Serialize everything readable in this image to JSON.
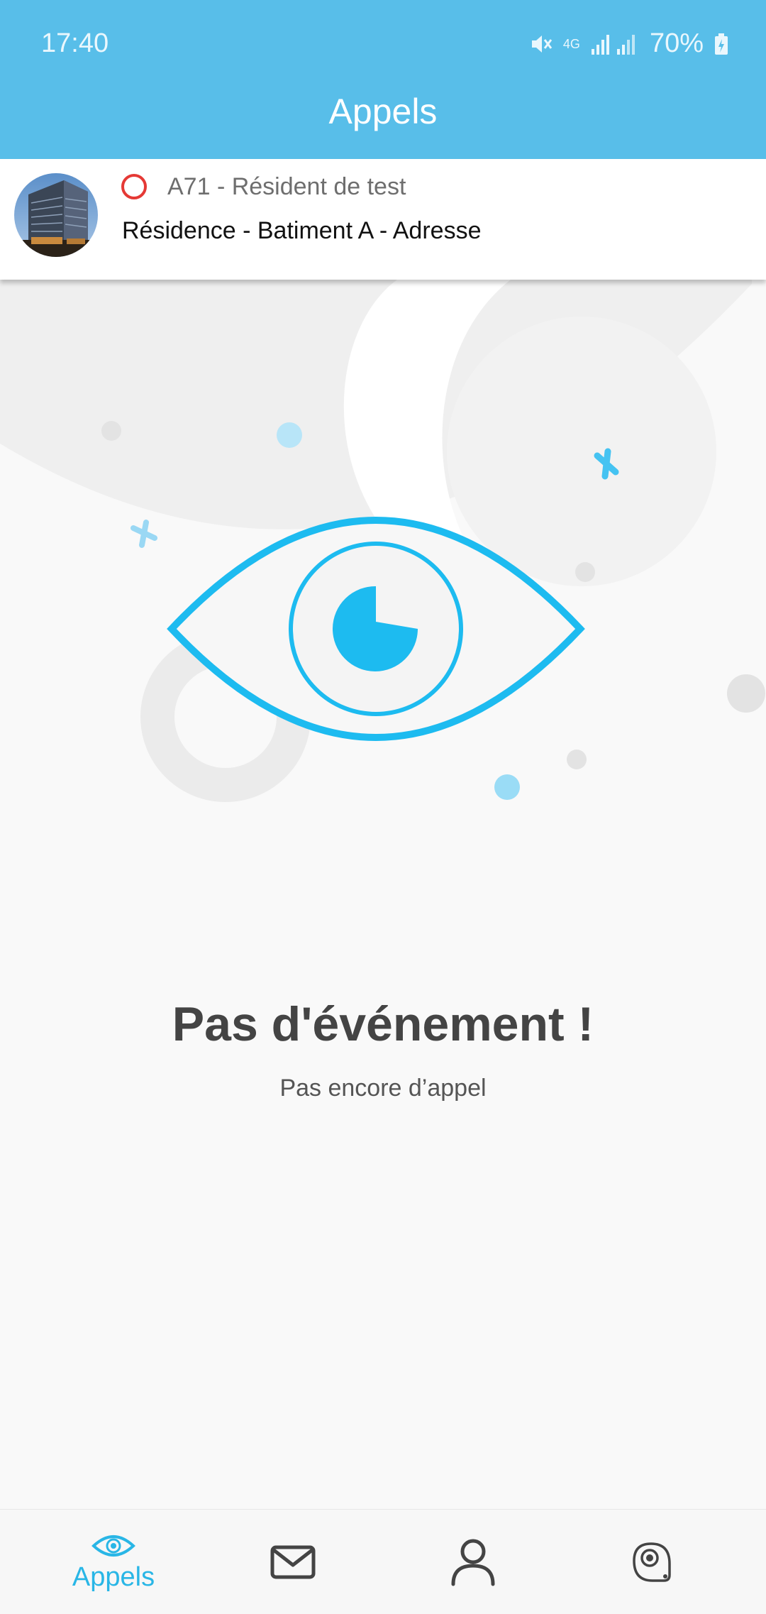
{
  "status_bar": {
    "time": "17:40",
    "network": "4G",
    "battery": "70%"
  },
  "header": {
    "title": "Appels"
  },
  "resident_card": {
    "name": "A71 - Résident de test",
    "address": "Résidence - Batiment A - Adresse",
    "status_color": "#e53935"
  },
  "empty_state": {
    "title": "Pas d'événement !",
    "subtitle": "Pas encore d’appel"
  },
  "tabs": [
    {
      "label": "Appels",
      "icon": "eye-icon",
      "active": true
    },
    {
      "label": "",
      "icon": "mail-icon",
      "active": false
    },
    {
      "label": "",
      "icon": "user-icon",
      "active": false
    },
    {
      "label": "",
      "icon": "camera-icon",
      "active": false
    }
  ],
  "colors": {
    "header": "#58bee9",
    "accent": "#1dbbf0",
    "tab_active": "#29b6e6"
  }
}
